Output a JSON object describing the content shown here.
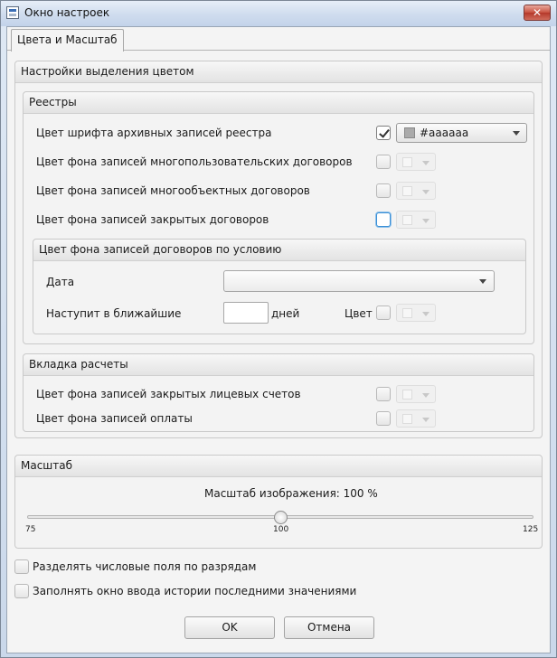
{
  "window": {
    "title": "Окно настроек",
    "close_glyph": "✕"
  },
  "tabs": [
    {
      "label": "Цвета и Масштаб",
      "active": true
    }
  ],
  "highlight_section": {
    "title": "Настройки выделения цветом",
    "registries": {
      "title": "Реестры",
      "rows": [
        {
          "label": "Цвет шрифта архивных записей реестра",
          "checked": true,
          "color_value": "#aaaaaa",
          "swatch_color": "#aaaaaa",
          "enabled": true
        },
        {
          "label": "Цвет фона записей многопользовательских договоров",
          "checked": false,
          "enabled": false
        },
        {
          "label": "Цвет фона записей многообъектных договоров",
          "checked": false,
          "enabled": false
        },
        {
          "label": "Цвет фона записей закрытых договоров",
          "checked": false,
          "enabled": false,
          "focused": true
        }
      ],
      "condition": {
        "title": "Цвет фона записей договоров по условию",
        "date_label": "Дата",
        "date_value": "",
        "upcoming_label": "Наступит в ближайшие",
        "days_value": "",
        "days_label": "дней",
        "color_label": "Цвет"
      }
    },
    "payments_tab": {
      "title": "Вкладка расчеты",
      "rows": [
        {
          "label": "Цвет фона записей закрытых лицевых счетов",
          "checked": false
        },
        {
          "label": "Цвет фона записей оплаты",
          "checked": false
        }
      ]
    }
  },
  "scale_section": {
    "title": "Масштаб",
    "caption": "Масштаб изображения: 100 %",
    "min": 75,
    "max": 125,
    "value": 100,
    "ticks": [
      "75",
      "100",
      "125"
    ]
  },
  "options": [
    {
      "label": "Разделять числовые поля по разрядам",
      "checked": false
    },
    {
      "label": "Заполнять окно ввода истории последними значениями",
      "checked": false
    }
  ],
  "buttons": {
    "ok": "OK",
    "cancel": "Отмена"
  },
  "colors": {
    "accent": "#3a8fd6",
    "close_button": "#c8503f"
  }
}
